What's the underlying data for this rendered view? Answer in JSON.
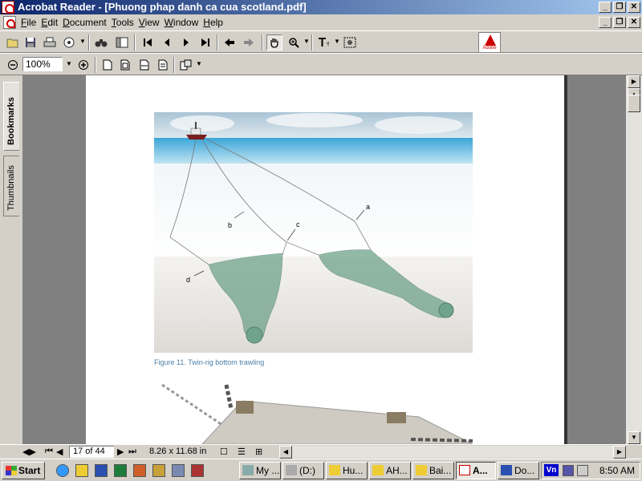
{
  "window": {
    "title": "Acrobat Reader - [Phuong phap danh ca cua scotland.pdf]",
    "minimize_glyph": "_",
    "restore_glyph": "❐",
    "close_glyph": "✕"
  },
  "menu": {
    "items": [
      "File",
      "Edit",
      "Document",
      "Tools",
      "View",
      "Window",
      "Help"
    ]
  },
  "toolbar": {
    "zoom_value": "100%",
    "adobe_logo_text": "Adobe"
  },
  "left_panel": {
    "tabs": [
      "Bookmarks",
      "Thumbnails"
    ]
  },
  "document": {
    "figure_caption": "Figure 11. Twin-rig bottom trawling",
    "figure_labels": {
      "a": "a",
      "b": "b",
      "c": "c",
      "d": "d"
    }
  },
  "statusbar": {
    "page_indicator": "17 of 44",
    "page_size": "8.26 x 11.68 in"
  },
  "taskbar": {
    "start_label": "Start",
    "tasks": [
      {
        "label": "My ...",
        "icon": "my-computer-icon"
      },
      {
        "label": "(D:)",
        "icon": "drive-icon"
      },
      {
        "label": "Hu...",
        "icon": "folder-icon"
      },
      {
        "label": "AH...",
        "icon": "folder-icon"
      },
      {
        "label": "Bai...",
        "icon": "folder-icon"
      },
      {
        "label": "A...",
        "icon": "acrobat-icon"
      },
      {
        "label": "Do...",
        "icon": "word-icon"
      }
    ],
    "tray_lang": "Vn",
    "clock": "8:50 AM"
  },
  "colors": {
    "titlebar_start": "#0a246a",
    "titlebar_end": "#a6caf0",
    "caption_text": "#4a7fa8",
    "net_green": "#6fa38a"
  }
}
